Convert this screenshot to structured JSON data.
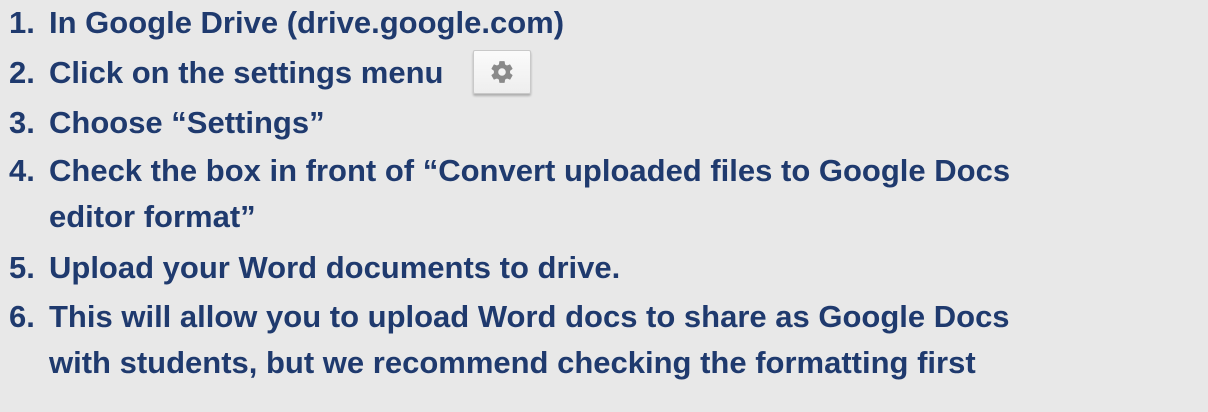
{
  "steps": [
    {
      "num": "1.",
      "lines": [
        "In Google Drive (drive.google.com)"
      ]
    },
    {
      "num": "2.",
      "lines": [
        "Click on the settings menu"
      ]
    },
    {
      "num": "3.",
      "lines": [
        "Choose “Settings”"
      ]
    },
    {
      "num": "4.",
      "lines": [
        "Check the box in front of “Convert uploaded files to Google Docs",
        "editor format”"
      ]
    },
    {
      "num": "5.",
      "lines": [
        "Upload your Word documents to drive."
      ]
    },
    {
      "num": "6.",
      "lines": [
        "This will allow you to upload Word docs to share as Google Docs",
        "with students, but we recommend checking the formatting first"
      ]
    }
  ],
  "icons": {
    "settings": "gear-icon"
  },
  "colors": {
    "text": "#1f3a6e",
    "background": "#e8e8e8"
  }
}
